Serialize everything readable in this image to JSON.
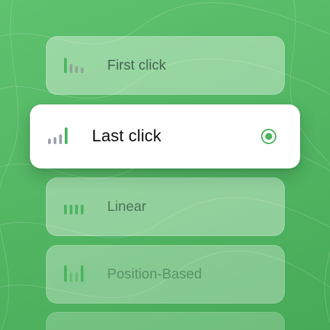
{
  "options": [
    {
      "label": "First click",
      "icon": "first-click-bars-icon",
      "selected": false
    },
    {
      "label": "Last click",
      "icon": "last-click-bars-icon",
      "selected": true
    },
    {
      "label": "Linear",
      "icon": "linear-bars-icon",
      "selected": false
    },
    {
      "label": "Position-Based",
      "icon": "position-based-bars-icon",
      "selected": false
    }
  ],
  "colors": {
    "accent_green": "#4cb45f",
    "muted_gray": "#9aa3ad",
    "background_green": "#53b764"
  }
}
